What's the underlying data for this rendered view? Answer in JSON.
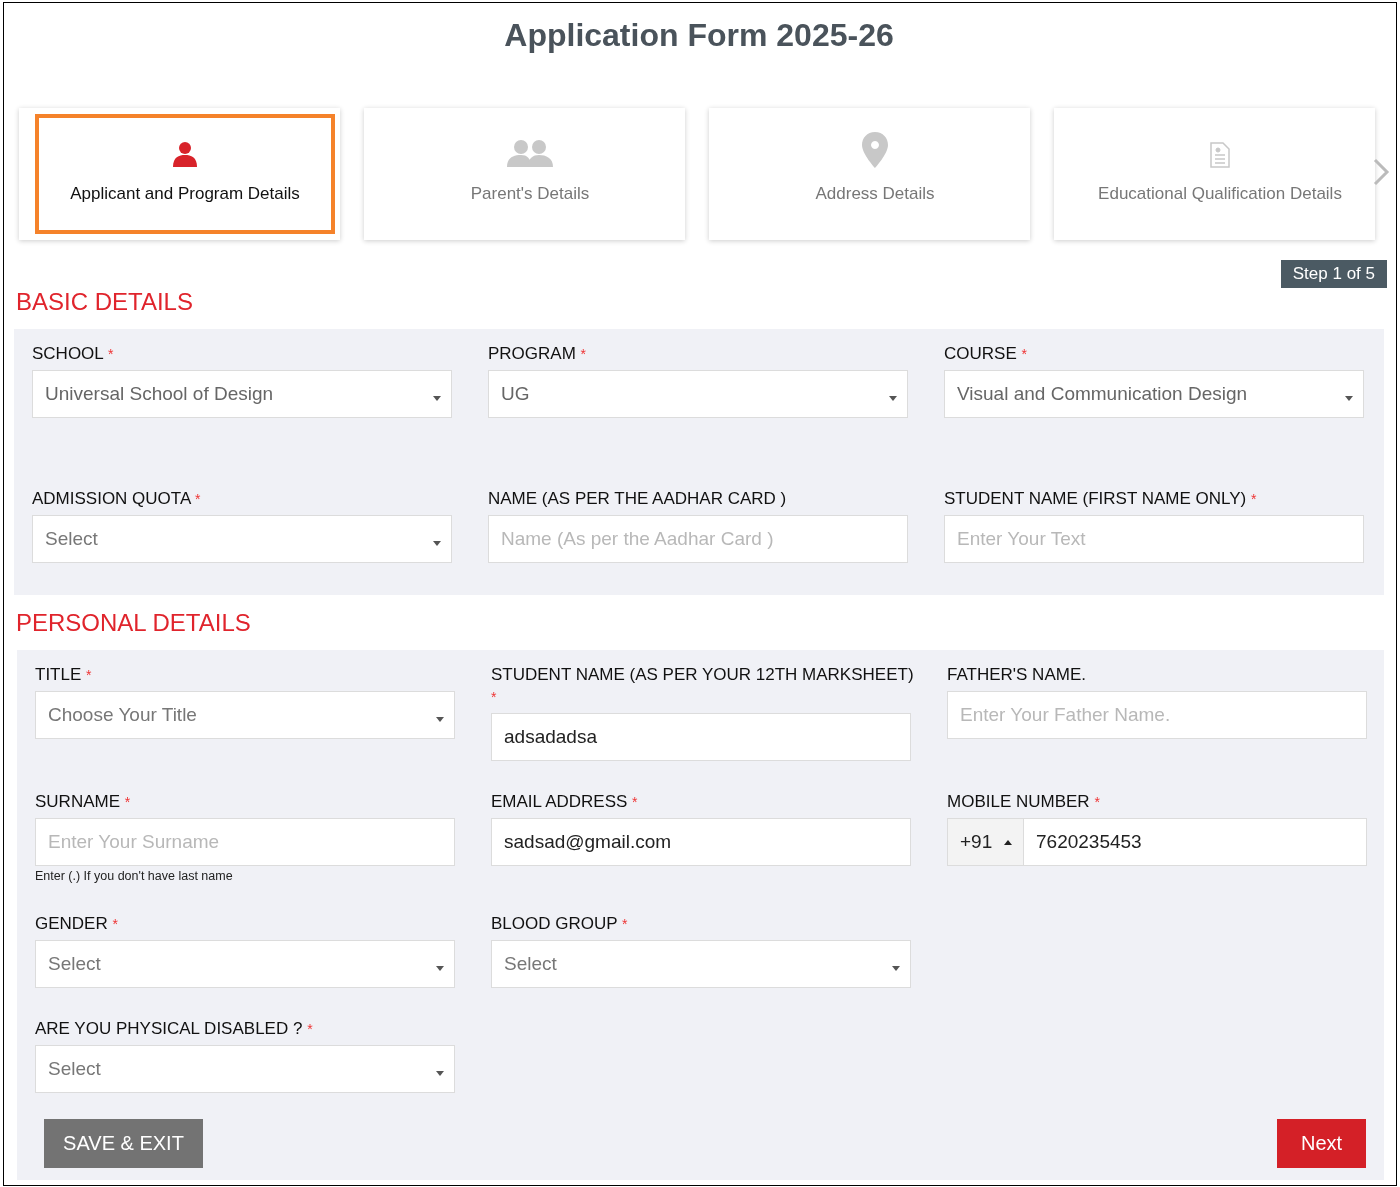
{
  "title": "Application Form 2025-26",
  "steps": [
    {
      "label": "Applicant and Program Details",
      "kind": "person",
      "selected": true
    },
    {
      "label": "Parent's Details",
      "kind": "people",
      "selected": false
    },
    {
      "label": "Address Details",
      "kind": "pin",
      "selected": false
    },
    {
      "label": "Educational Qualification Details",
      "kind": "document",
      "selected": false
    }
  ],
  "step_counter": "Step 1 of 5",
  "sections": [
    {
      "title": "BASIC DETAILS",
      "fields": [
        {
          "label": "SCHOOL",
          "mark": "*",
          "kind": "select",
          "value": "Universal School of Design"
        },
        {
          "label": "PROGRAM",
          "mark": "*",
          "kind": "select",
          "value": "UG"
        },
        {
          "label": "COURSE",
          "mark": "*",
          "kind": "select",
          "value": "Visual and Communication Design"
        },
        {
          "label": "ADMISSION QUOTA",
          "mark": "*",
          "kind": "select",
          "placeholder": "Select"
        },
        {
          "label": "NAME (AS PER THE AADHAR CARD )",
          "kind": "text",
          "placeholder": "Name (As per the Aadhar Card )"
        },
        {
          "label": "STUDENT NAME (FIRST NAME ONLY)",
          "mark": "*",
          "kind": "text",
          "placeholder": "Enter Your Text"
        }
      ]
    },
    {
      "title": "PERSONAL DETAILS",
      "fields": [
        {
          "label": "TITLE",
          "mark": "*",
          "kind": "select",
          "placeholder": "Choose Your Title"
        },
        {
          "label": "STUDENT NAME (AS PER YOUR 12TH MARKSHEET)",
          "mark": "*",
          "kind": "text",
          "value": "adsadadsa"
        },
        {
          "label": "FATHER'S NAME.",
          "kind": "text",
          "placeholder": "Enter Your Father Name."
        },
        {
          "label": "SURNAME",
          "mark": "*",
          "kind": "text",
          "placeholder": "Enter Your Surname",
          "hint": "Enter (.) If you don't have last name"
        },
        {
          "label": "EMAIL ADDRESS",
          "mark": "*",
          "kind": "text",
          "value": "sadsad@gmail.com"
        },
        {
          "label": "MOBILE NUMBER",
          "mark": "*",
          "kind": "phone",
          "code": "+91",
          "value": "7620235453"
        },
        {
          "label": "GENDER",
          "mark": "*",
          "kind": "select",
          "placeholder": "Select"
        },
        {
          "label": "BLOOD GROUP",
          "mark": "*",
          "kind": "select",
          "placeholder": "Select"
        },
        {
          "label": "ARE YOU PHYSICAL DISABLED ?",
          "mark": "*",
          "kind": "select",
          "placeholder": "Select"
        }
      ]
    }
  ],
  "buttons": [
    {
      "label": "SAVE & EXIT",
      "kind": "secondary"
    },
    {
      "label": "Next",
      "kind": "primary"
    }
  ]
}
